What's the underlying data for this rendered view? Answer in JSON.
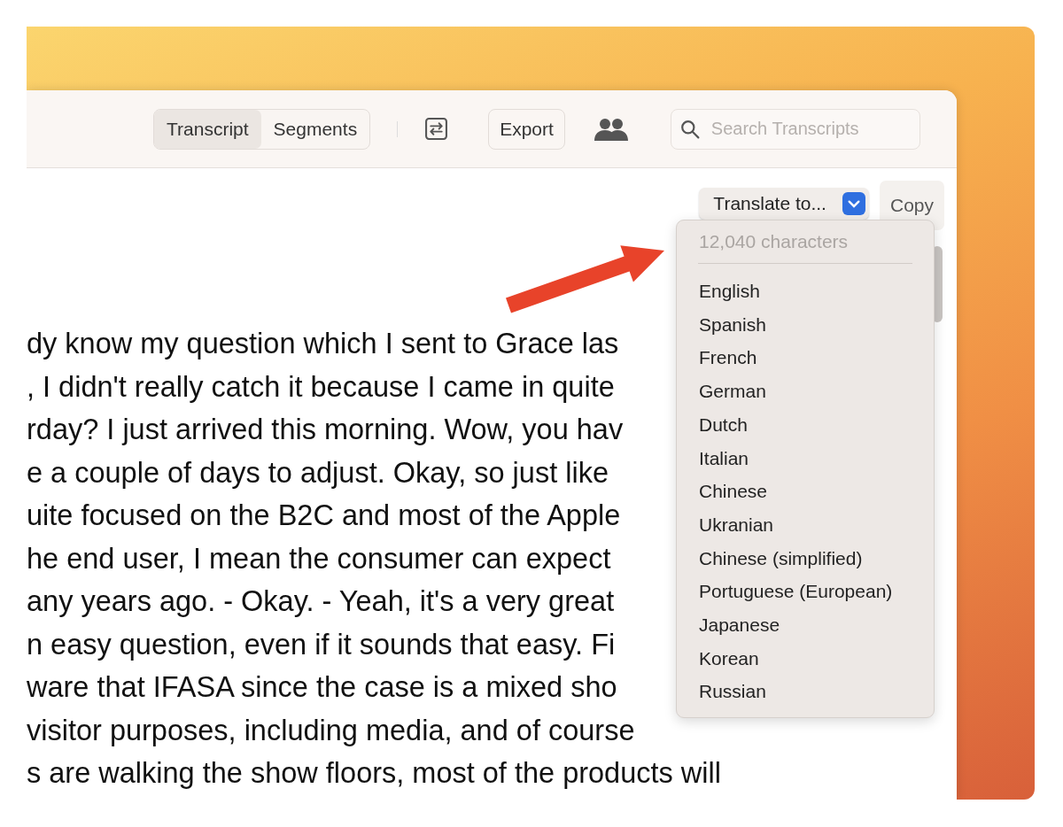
{
  "toolbar": {
    "view_tabs": [
      {
        "label": "Transcript",
        "selected": true
      },
      {
        "label": "Segments",
        "selected": false
      }
    ],
    "export_button": "Export",
    "search": {
      "placeholder": "Search Transcripts"
    }
  },
  "content": {
    "translate_select": "Translate to...",
    "copy_button": "Copy",
    "transcript_lines": [
      "dy know my question which I sent to Grace las",
      ", I didn't really catch it because I came in quite",
      "rday? I just arrived this morning. Wow, you hav",
      "e a couple of days to adjust. Okay, so just like",
      "uite focused on the B2C and most of the Apple",
      "he end user, I mean the consumer can expect",
      "any years ago. - Okay. - Yeah, it's a very great",
      "n easy question, even if it sounds that easy. Fi",
      "ware that IFASA since the case is a mixed sho",
      "visitor purposes, including media, and of course",
      "s are walking the show floors, most of the products will"
    ]
  },
  "translate_menu": {
    "character_count": "12,040 characters",
    "languages": [
      "English",
      "Spanish",
      "French",
      "German",
      "Dutch",
      "Italian",
      "Chinese",
      "Ukranian",
      "Chinese (simplified)",
      "Portuguese (European)",
      "Japanese",
      "Korean",
      "Russian"
    ]
  }
}
